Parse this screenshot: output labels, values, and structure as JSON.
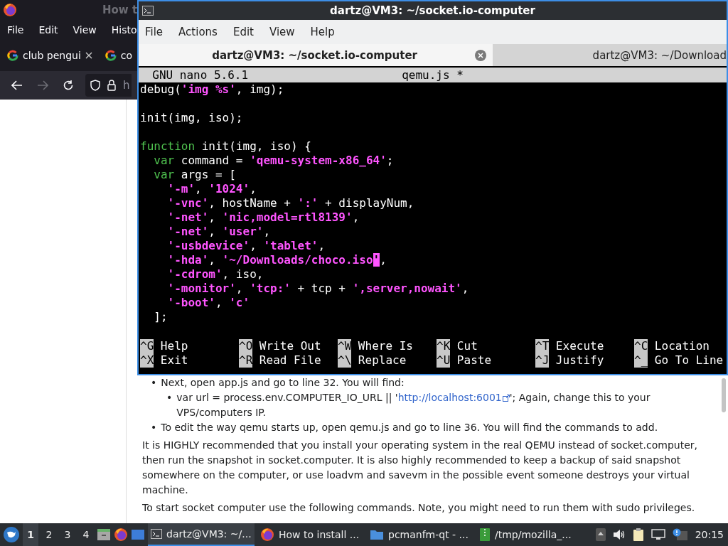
{
  "browser": {
    "title": "How t",
    "menu": [
      "File",
      "Edit",
      "View",
      "Histo"
    ],
    "tabs": [
      {
        "label": "club pengui",
        "closable": true
      },
      {
        "label": "co",
        "closable": false
      }
    ],
    "address": "h",
    "article": {
      "bullets": [
        {
          "marker": "•",
          "text": "Next, open app.js and go to line 32. You will find:",
          "children": [
            {
              "marker": "•",
              "before": "var url = process.env.COMPUTER_IO_URL || '",
              "link": "http://localhost:6001",
              "after": "'; Again, change this to your VPS/computers IP."
            }
          ]
        },
        {
          "marker": "•",
          "text": "To edit the way qemu starts up, open qemu.js and go to line 36. You will find the commands to add."
        }
      ],
      "paragraphs": [
        "It is HIGHLY recommended that you install your operating system in the real QEMU instead of socket.computer, then run the snapshot in socket.computer. It is also highly recommended to keep a backup of said snapshot somewhere on the computer, or use loadvm and savevm in the possible event someone destroys your virtual machine.",
        "To start socket computer use the following commands. Note, you might need to run them with sudo privileges."
      ]
    }
  },
  "terminal": {
    "title": "dartz@VM3: ~/socket.io-computer",
    "menu": [
      "File",
      "Actions",
      "Edit",
      "View",
      "Help"
    ],
    "tabs": [
      {
        "label": "dartz@VM3: ~/socket.io-computer",
        "selected": true
      },
      {
        "label": "dartz@VM3: ~/Download",
        "selected": false
      }
    ],
    "nano": {
      "version": "GNU nano 5.6.1",
      "filename": "qemu.js *",
      "lines": [
        {
          "kind": "code",
          "segments": [
            {
              "kind": "plain",
              "text": "debug("
            },
            {
              "kind": "string",
              "text": "'img %s'"
            },
            {
              "kind": "plain",
              "text": ", img);"
            }
          ]
        },
        {
          "kind": "blank"
        },
        {
          "kind": "code",
          "segments": [
            {
              "kind": "plain",
              "text": "init(img, iso);"
            }
          ]
        },
        {
          "kind": "blank"
        },
        {
          "kind": "code",
          "segments": [
            {
              "kind": "keyword",
              "text": "function"
            },
            {
              "kind": "plain",
              "text": " init(img, iso) {"
            }
          ],
          "children": [
            {
              "kind": "code",
              "segments": [
                {
                  "kind": "keyword",
                  "text": "var"
                },
                {
                  "kind": "plain",
                  "text": " command = "
                },
                {
                  "kind": "string",
                  "text": "'qemu-system-x86_64'"
                },
                {
                  "kind": "plain",
                  "text": ";"
                }
              ]
            },
            {
              "kind": "code",
              "segments": [
                {
                  "kind": "keyword",
                  "text": "var"
                },
                {
                  "kind": "plain",
                  "text": " args = ["
                }
              ],
              "children": [
                {
                  "kind": "code",
                  "segments": [
                    {
                      "kind": "string",
                      "text": "'-m'"
                    },
                    {
                      "kind": "plain",
                      "text": ", "
                    },
                    {
                      "kind": "string",
                      "text": "'1024'"
                    },
                    {
                      "kind": "plain",
                      "text": ","
                    }
                  ]
                },
                {
                  "kind": "code",
                  "segments": [
                    {
                      "kind": "string",
                      "text": "'-vnc'"
                    },
                    {
                      "kind": "plain",
                      "text": ", hostName + "
                    },
                    {
                      "kind": "string",
                      "text": "':'"
                    },
                    {
                      "kind": "plain",
                      "text": " + displayNum,"
                    }
                  ]
                },
                {
                  "kind": "code",
                  "segments": [
                    {
                      "kind": "string",
                      "text": "'-net'"
                    },
                    {
                      "kind": "plain",
                      "text": ", "
                    },
                    {
                      "kind": "string",
                      "text": "'nic,model=rtl8139'"
                    },
                    {
                      "kind": "plain",
                      "text": ","
                    }
                  ]
                },
                {
                  "kind": "code",
                  "segments": [
                    {
                      "kind": "string",
                      "text": "'-net'"
                    },
                    {
                      "kind": "plain",
                      "text": ", "
                    },
                    {
                      "kind": "string",
                      "text": "'user'"
                    },
                    {
                      "kind": "plain",
                      "text": ","
                    }
                  ]
                },
                {
                  "kind": "code",
                  "segments": [
                    {
                      "kind": "string",
                      "text": "'-usbdevice'"
                    },
                    {
                      "kind": "plain",
                      "text": ", "
                    },
                    {
                      "kind": "string",
                      "text": "'tablet'"
                    },
                    {
                      "kind": "plain",
                      "text": ","
                    }
                  ]
                },
                {
                  "kind": "code",
                  "segments": [
                    {
                      "kind": "string",
                      "text": "'-hda'"
                    },
                    {
                      "kind": "plain",
                      "text": ", "
                    },
                    {
                      "kind": "string",
                      "text": "'~/Downloads/choco.iso"
                    },
                    {
                      "kind": "cursor",
                      "text": "'"
                    },
                    {
                      "kind": "plain",
                      "text": ","
                    }
                  ]
                },
                {
                  "kind": "code",
                  "segments": [
                    {
                      "kind": "string",
                      "text": "'-cdrom'"
                    },
                    {
                      "kind": "plain",
                      "text": ", iso,"
                    }
                  ]
                },
                {
                  "kind": "code",
                  "segments": [
                    {
                      "kind": "string",
                      "text": "'-monitor'"
                    },
                    {
                      "kind": "plain",
                      "text": ", "
                    },
                    {
                      "kind": "string",
                      "text": "'tcp:'"
                    },
                    {
                      "kind": "plain",
                      "text": " + tcp + "
                    },
                    {
                      "kind": "string",
                      "text": "',server,nowait'"
                    },
                    {
                      "kind": "plain",
                      "text": ","
                    }
                  ]
                },
                {
                  "kind": "code",
                  "segments": [
                    {
                      "kind": "string",
                      "text": "'-boot'"
                    },
                    {
                      "kind": "plain",
                      "text": ", "
                    },
                    {
                      "kind": "string",
                      "text": "'c'"
                    }
                  ]
                }
              ]
            },
            {
              "kind": "code",
              "segments": [
                {
                  "kind": "plain",
                  "text": "];"
                }
              ]
            }
          ]
        }
      ],
      "shortcuts": [
        [
          {
            "key": "^G",
            "label": "Help"
          },
          {
            "key": "^O",
            "label": "Write Out"
          },
          {
            "key": "^W",
            "label": "Where Is"
          },
          {
            "key": "^K",
            "label": "Cut"
          },
          {
            "key": "^T",
            "label": "Execute"
          },
          {
            "key": "^C",
            "label": "Location"
          }
        ],
        [
          {
            "key": "^X",
            "label": "Exit"
          },
          {
            "key": "^R",
            "label": "Read File"
          },
          {
            "key": "^\\",
            "label": "Replace"
          },
          {
            "key": "^U",
            "label": "Paste"
          },
          {
            "key": "^J",
            "label": "Justify"
          },
          {
            "key": "^_",
            "label": "Go To Line"
          }
        ]
      ]
    }
  },
  "taskbar": {
    "workspaces": [
      {
        "label": "1",
        "selected": true
      },
      {
        "label": "2",
        "selected": false
      },
      {
        "label": "3",
        "selected": false
      },
      {
        "label": "4",
        "selected": false
      }
    ],
    "tasks": [
      {
        "kind": "terminal",
        "label": "dartz@VM3: ~/...",
        "selected": true
      },
      {
        "kind": "browser",
        "label": "How to install ...",
        "selected": false
      },
      {
        "kind": "folder",
        "label": "pcmanfm-qt - ...",
        "selected": false
      },
      {
        "kind": "archive",
        "label": "/tmp/mozilla_...",
        "selected": false
      }
    ],
    "clock": "20:15"
  }
}
